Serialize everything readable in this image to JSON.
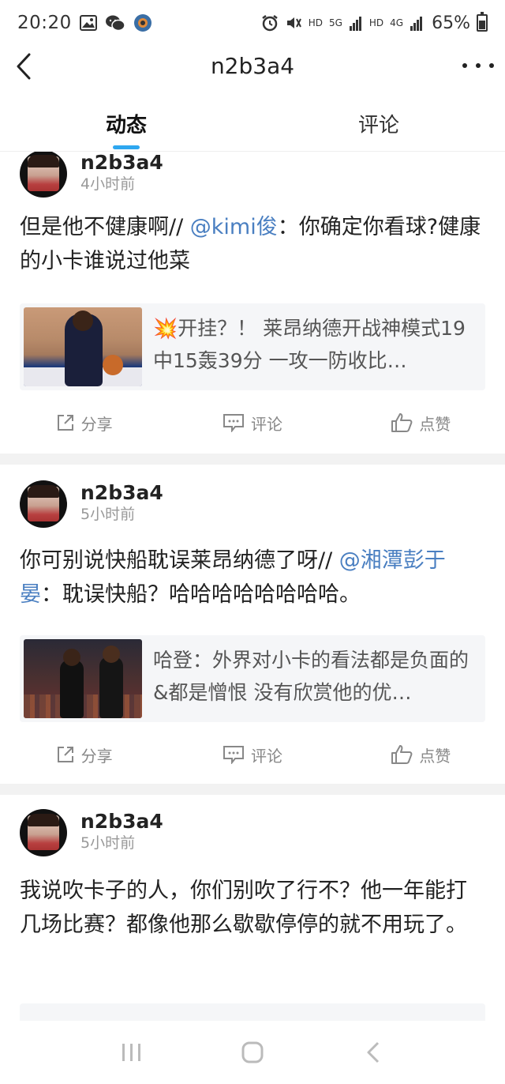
{
  "status_bar": {
    "time": "20:20",
    "battery": "65%",
    "network_1": "HD",
    "network_2": "5G",
    "network_3": "HD",
    "network_4": "4G"
  },
  "header": {
    "title": "n2b3a4"
  },
  "tabs": [
    {
      "label": "动态",
      "active": true
    },
    {
      "label": "评论",
      "active": false
    }
  ],
  "posts": [
    {
      "username": "n2b3a4",
      "time": "4小时前",
      "text_main": "但是他不健康啊// ",
      "mention": "@kimi俊",
      "text_rest": "：你确定你看球?健康的小卡谁说过他菜",
      "card_text": "💥开挂？！ 莱昂纳德开战神模式19中15轰39分 一攻一防收比…"
    },
    {
      "username": "n2b3a4",
      "time": "5小时前",
      "text_main": "你可别说快船耽误莱昂纳德了呀// ",
      "mention": "@湘潭彭于晏",
      "text_rest": "：耽误快船？哈哈哈哈哈哈哈哈。",
      "card_text": "哈登：外界对小卡的看法都是负面的&都是憎恨 没有欣赏他的优…"
    },
    {
      "username": "n2b3a4",
      "time": "5小时前",
      "text_main": "我说吹卡子的人，你们别吹了行不？他一年能打几场比赛？都像他那么歇歇停停的就不用玩了。"
    }
  ],
  "actions": {
    "share": "分享",
    "comment": "评论",
    "like": "点赞"
  }
}
